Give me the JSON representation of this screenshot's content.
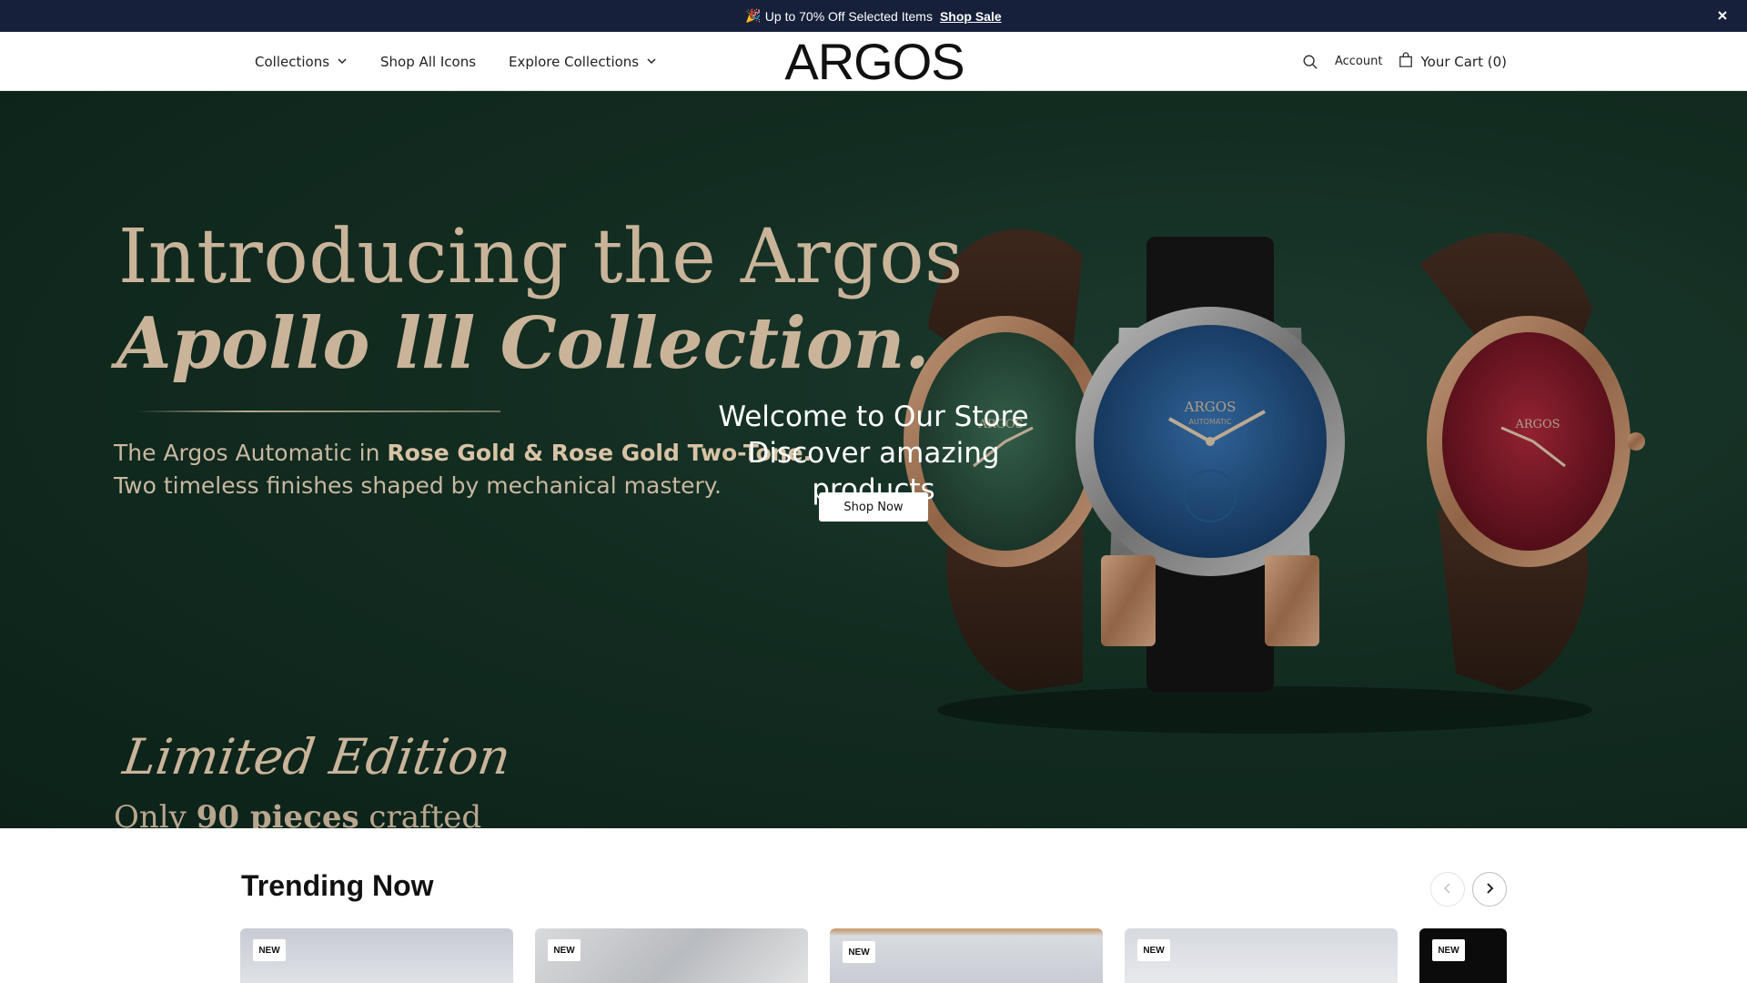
{
  "announcement": {
    "emoji": "🎉",
    "text": "Up to 70% Off Selected Items",
    "link": "Shop Sale"
  },
  "header": {
    "logo": "ARGOS",
    "nav": [
      {
        "label": "Collections",
        "dropdown": true
      },
      {
        "label": "Shop All Icons",
        "dropdown": false
      },
      {
        "label": "Explore Collections",
        "dropdown": true
      }
    ],
    "account": "Account",
    "cart": "Your Cart (0)",
    "icons": {
      "search": "search-icon",
      "bag": "bag-icon",
      "close": "close-icon"
    }
  },
  "hero": {
    "title_line1": "Introducing the Argos",
    "title_line2": "Apollo lll Collection.",
    "subtitle_prefix": "The Argos Automatic in ",
    "subtitle_bold": "Rose Gold & Rose Gold Two-Tone.",
    "subtitle_line2": "Two timeless finishes shaped by mechanical mastery.",
    "limited": "Limited Edition",
    "only_prefix": "Only ",
    "only_bold": "90 pieces",
    "only_suffix": " crafted",
    "overlay_line1": "Welcome to Our Store",
    "overlay_line2": "Discover amazing products",
    "cta": "Shop Now",
    "watch_brand": "ARGOS",
    "watch_sub": "AUTOMATIC",
    "colors": {
      "bg": "#173628",
      "gold": "#c9b49a",
      "green_dial": "#2f5a45",
      "blue_dial": "#1f4f86",
      "red_dial": "#8a1a2a"
    }
  },
  "trending": {
    "title": "Trending Now",
    "badges": [
      "NEW",
      "NEW",
      "NEW",
      "NEW",
      "NEW"
    ]
  }
}
